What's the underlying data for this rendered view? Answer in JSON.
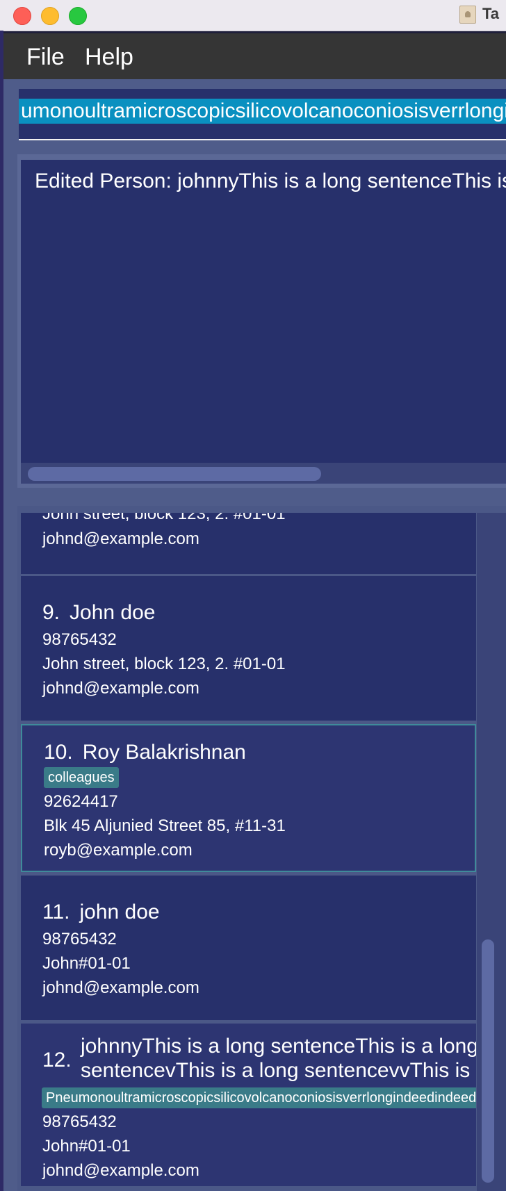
{
  "window": {
    "title": "Ta"
  },
  "menu": {
    "file": "File",
    "help": "Help"
  },
  "command_box": {
    "value": "umonoultramicroscopicsilicovolcanoconiosisverrlongindeedindeed"
  },
  "result_display": {
    "text": "Edited Person: johnnyThis is a long sentenceThis is a long sentence"
  },
  "persons": [
    {
      "index": "",
      "name": "",
      "tag": "",
      "phone": "",
      "address": "John street, block 123, 2. #01-01",
      "email": "johnd@example.com"
    },
    {
      "index": "9.",
      "name": "John doe",
      "phone": "98765432",
      "address": "John street, block 123, 2. #01-01",
      "email": "johnd@example.com"
    },
    {
      "index": "10.",
      "name": "Roy Balakrishnan",
      "tag": "colleagues",
      "phone": "92624417",
      "address": "Blk 45 Aljunied Street 85, #11-31",
      "email": "royb@example.com"
    },
    {
      "index": "11.",
      "name": "john doe",
      "phone": "98765432",
      "address": "John#01-01",
      "email": "johnd@example.com"
    },
    {
      "index": "12.",
      "name_line1": "johnnyThis is a long sentenceThis is a long",
      "name_line2": "sentencevThis is a long sentencevvThis is a",
      "tag": "Pneumonoultramicroscopicsilicovolcanoconiosisverrlongindeedindeed",
      "phone": "98765432",
      "address": "John#01-01",
      "email": "johnd@example.com"
    }
  ]
}
